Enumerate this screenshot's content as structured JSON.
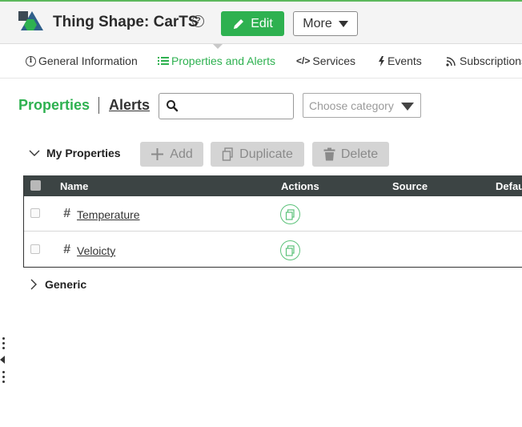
{
  "header": {
    "title": "Thing Shape: CarTS",
    "help_glyph": "?",
    "edit_label": "Edit",
    "more_label": "More"
  },
  "tabs": [
    {
      "label": "General Information",
      "active": false
    },
    {
      "label": "Properties and Alerts",
      "active": true
    },
    {
      "label": "Services",
      "active": false
    },
    {
      "label": "Events",
      "active": false
    },
    {
      "label": "Subscriptions",
      "active": false
    }
  ],
  "subnav": {
    "properties_label": "Properties",
    "alerts_label": "Alerts",
    "search_value": "",
    "category_placeholder": "Choose category"
  },
  "section": {
    "label": "My Properties",
    "add_label": "Add",
    "duplicate_label": "Duplicate",
    "delete_label": "Delete"
  },
  "table": {
    "columns": [
      "Name",
      "Actions",
      "Source",
      "Defau"
    ],
    "rows": [
      {
        "name": "Temperature"
      },
      {
        "name": "Veloicty"
      }
    ]
  },
  "generic_section": {
    "label": "Generic"
  },
  "colors": {
    "accent": "#2eb150",
    "header_bar": "#3c4444"
  }
}
